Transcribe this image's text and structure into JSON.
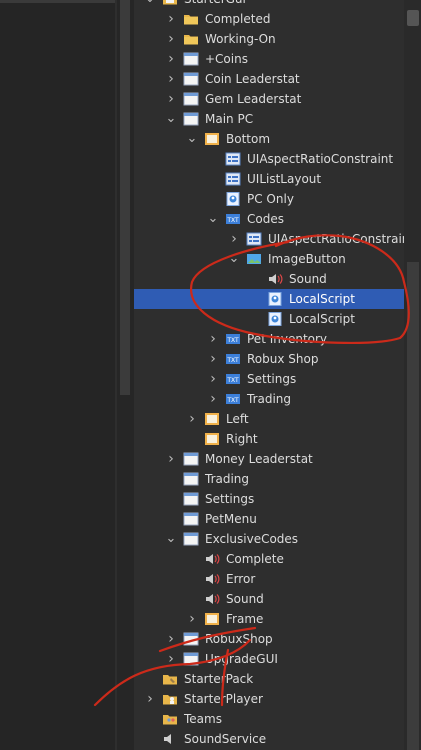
{
  "tree": [
    {
      "label": "StarterGui",
      "indent": 0,
      "arrow": "down",
      "icon": "startergui-icon"
    },
    {
      "label": "Completed",
      "indent": 1,
      "arrow": "right",
      "icon": "folder-icon"
    },
    {
      "label": "Working-On",
      "indent": 1,
      "arrow": "right",
      "icon": "folder-icon"
    },
    {
      "label": "+Coins",
      "indent": 1,
      "arrow": "right",
      "icon": "screengui-icon"
    },
    {
      "label": "Coin Leaderstat",
      "indent": 1,
      "arrow": "right",
      "icon": "screengui-icon"
    },
    {
      "label": "Gem Leaderstat",
      "indent": 1,
      "arrow": "right",
      "icon": "screengui-icon"
    },
    {
      "label": "Main PC",
      "indent": 1,
      "arrow": "down",
      "icon": "screengui-icon"
    },
    {
      "label": "Bottom",
      "indent": 2,
      "arrow": "down",
      "icon": "frame-icon"
    },
    {
      "label": "UIAspectRatioConstraint",
      "indent": 3,
      "arrow": "",
      "icon": "uiconstraint-icon"
    },
    {
      "label": "UIListLayout",
      "indent": 3,
      "arrow": "",
      "icon": "uiconstraint-icon"
    },
    {
      "label": "PC Only",
      "indent": 3,
      "arrow": "",
      "icon": "localscript-icon"
    },
    {
      "label": "Codes",
      "indent": 3,
      "arrow": "down",
      "icon": "textbutton-icon"
    },
    {
      "label": "UIAspectRatioConstrain",
      "indent": 4,
      "arrow": "right",
      "icon": "uiconstraint-icon"
    },
    {
      "label": "ImageButton",
      "indent": 4,
      "arrow": "down",
      "icon": "imagebutton-icon"
    },
    {
      "label": "Sound",
      "indent": 5,
      "arrow": "",
      "icon": "sound-icon"
    },
    {
      "label": "LocalScript",
      "indent": 5,
      "arrow": "",
      "icon": "localscript-icon",
      "selected": true
    },
    {
      "label": "LocalScript",
      "indent": 5,
      "arrow": "",
      "icon": "localscript-icon"
    },
    {
      "label": "Pet Inventory",
      "indent": 3,
      "arrow": "right",
      "icon": "textbutton-icon"
    },
    {
      "label": "Robux Shop",
      "indent": 3,
      "arrow": "right",
      "icon": "textbutton-icon"
    },
    {
      "label": "Settings",
      "indent": 3,
      "arrow": "right",
      "icon": "textbutton-icon"
    },
    {
      "label": "Trading",
      "indent": 3,
      "arrow": "right",
      "icon": "textbutton-icon"
    },
    {
      "label": "Left",
      "indent": 2,
      "arrow": "right",
      "icon": "frame-icon"
    },
    {
      "label": "Right",
      "indent": 2,
      "arrow": "",
      "icon": "frame-icon"
    },
    {
      "label": "Money Leaderstat",
      "indent": 1,
      "arrow": "right",
      "icon": "screengui-icon"
    },
    {
      "label": "Trading",
      "indent": 1,
      "arrow": "",
      "icon": "screengui-icon"
    },
    {
      "label": "Settings",
      "indent": 1,
      "arrow": "",
      "icon": "screengui-icon"
    },
    {
      "label": "PetMenu",
      "indent": 1,
      "arrow": "",
      "icon": "screengui-icon"
    },
    {
      "label": "ExclusiveCodes",
      "indent": 1,
      "arrow": "down",
      "icon": "screengui-icon"
    },
    {
      "label": "Complete",
      "indent": 2,
      "arrow": "",
      "icon": "sound-icon"
    },
    {
      "label": "Error",
      "indent": 2,
      "arrow": "",
      "icon": "sound-icon"
    },
    {
      "label": "Sound",
      "indent": 2,
      "arrow": "",
      "icon": "sound-icon"
    },
    {
      "label": "Frame",
      "indent": 2,
      "arrow": "right",
      "icon": "frame-icon"
    },
    {
      "label": "RobuxShop",
      "indent": 1,
      "arrow": "right",
      "icon": "screengui-icon"
    },
    {
      "label": "UpgradeGUI",
      "indent": 1,
      "arrow": "right",
      "icon": "screengui-icon"
    },
    {
      "label": "StarterPack",
      "indent": 0,
      "arrow": "",
      "icon": "starterpack-icon"
    },
    {
      "label": "StarterPlayer",
      "indent": 0,
      "arrow": "right",
      "icon": "starterplayer-icon"
    },
    {
      "label": "Teams",
      "indent": 0,
      "arrow": "",
      "icon": "teams-icon"
    },
    {
      "label": "SoundService",
      "indent": 0,
      "arrow": "",
      "icon": "soundservice-icon"
    }
  ],
  "colors": {
    "selection": "#2f5cb4",
    "annotation": "#cc2a1a"
  }
}
